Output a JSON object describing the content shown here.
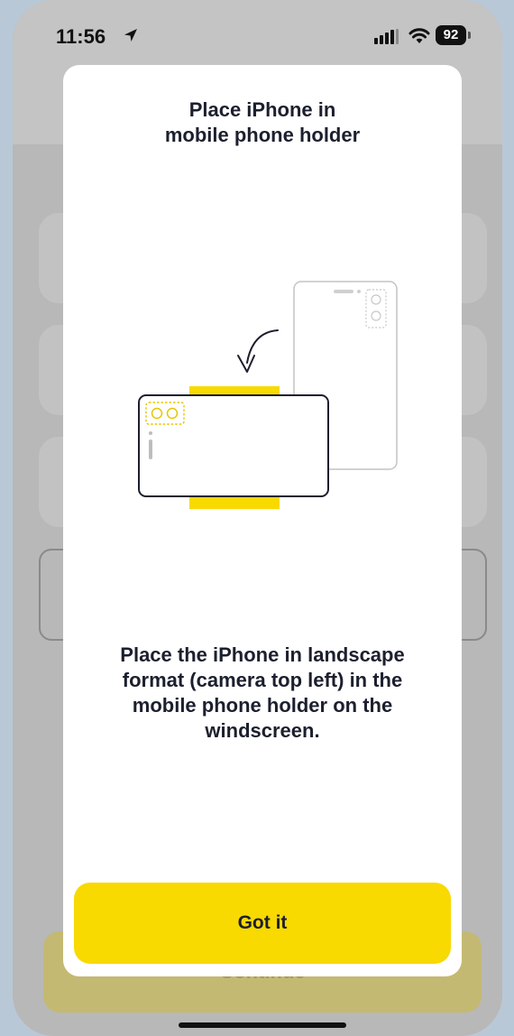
{
  "status_bar": {
    "time": "11:56",
    "battery_level": "92",
    "icons": [
      "location-arrow-icon",
      "cellular-signal-icon",
      "wifi-icon",
      "battery-icon"
    ]
  },
  "background_screen": {
    "continue_label": "Continue"
  },
  "sheet": {
    "title_line1": "Place iPhone in",
    "title_line2": "mobile phone holder",
    "body_line1": "Place the iPhone in landscape",
    "body_line2": "format (camera top left) in the",
    "body_line3": "mobile phone holder on the",
    "body_line4": "windscreen.",
    "button_label": "Got it",
    "illustration_icon": "phone-in-holder-illustration"
  },
  "colors": {
    "accent_yellow": "#f8d900",
    "text_dark": "#1c1f2e",
    "overlay_gray": "#b8b8b8",
    "outer_background": "#b9c8d6"
  }
}
